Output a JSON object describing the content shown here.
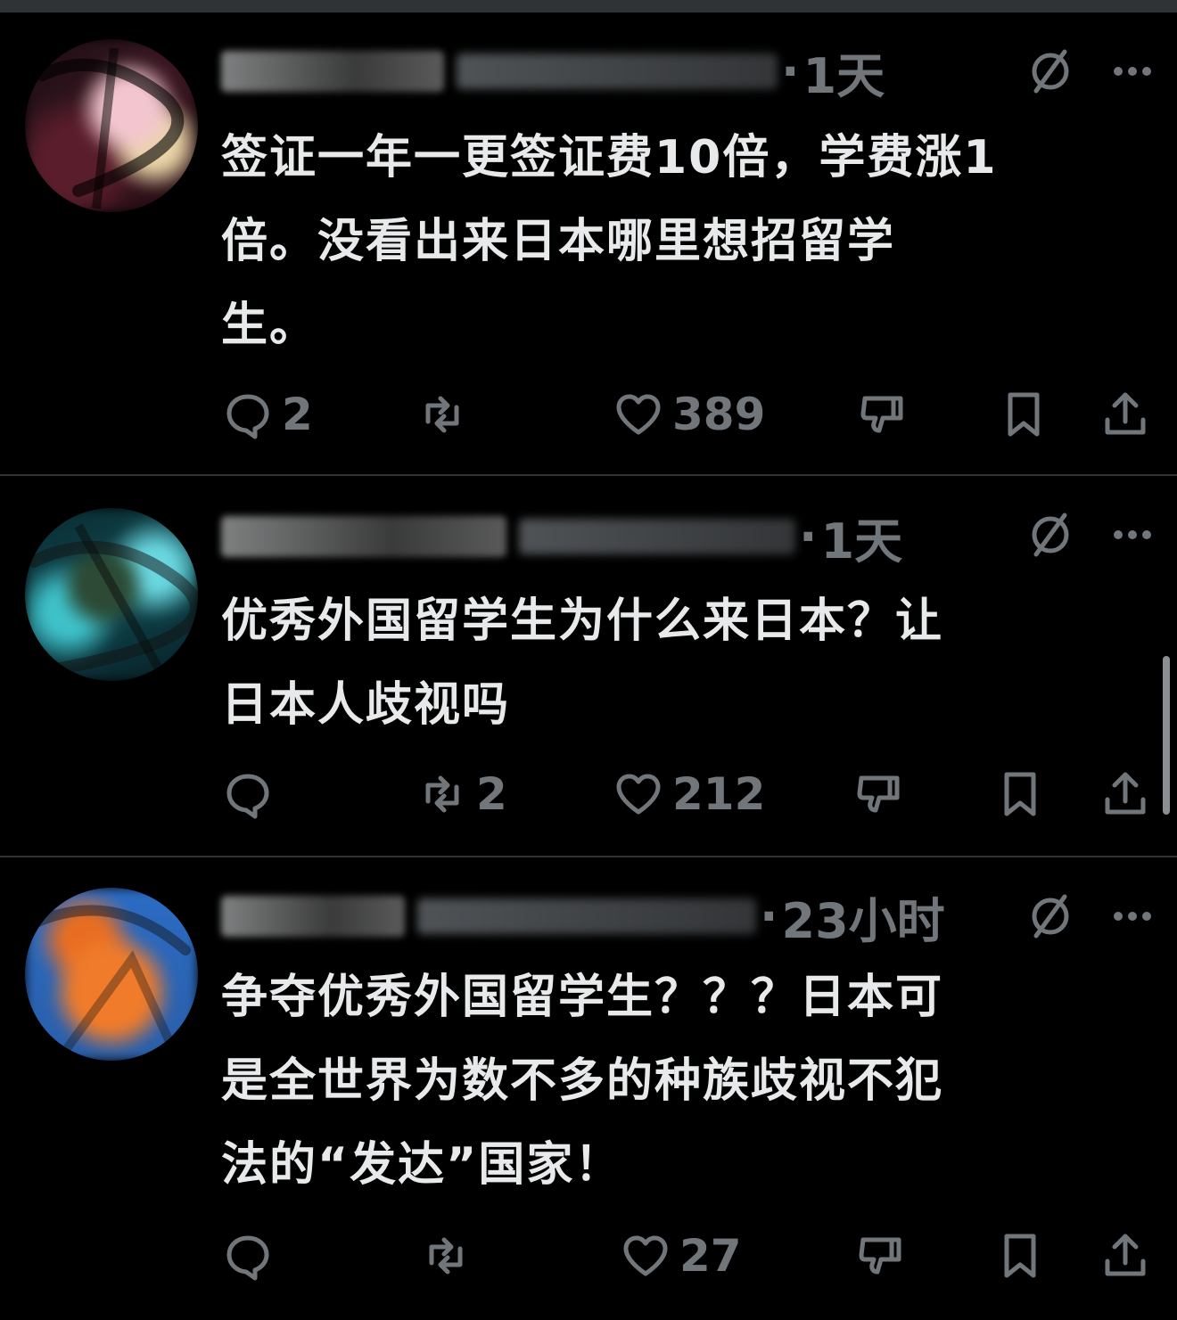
{
  "tweets": [
    {
      "name": "肥宅之蛙",
      "handle": "@humoregift",
      "time": "1天",
      "text": "签证一年一更签证费10倍，学费涨1倍。没看出来日本哪里想招留学生。",
      "lines": [
        "签证一年一更签证费10倍，学费涨1",
        "倍。没看出来日本哪里想招留学",
        "生。"
      ],
      "replies": "2",
      "retweets": "",
      "likes": "389"
    },
    {
      "name": "自由小蜜红",
      "handle": "@stagehs...",
      "time": "1天",
      "text": "优秀外国留学生为什么来日本？让日本人歧视吗",
      "lines": [
        "优秀外国留学生为什么来日本？让",
        "日本人歧视吗"
      ],
      "replies": "",
      "retweets": "2",
      "likes": "212"
    },
    {
      "name": "阿蒙.AI",
      "handle": "@hello_boris",
      "time": "23小时",
      "text": "争夺优秀外国留学生？？？日本可是全世界为数不多的种族歧视不犯法的“发达”国家！",
      "lines": [
        "争夺优秀外国留学生？？？日本可",
        "是全世界为数不多的种族歧视不犯",
        "法的“发达”国家！"
      ],
      "replies": "",
      "retweets": "",
      "likes": "27"
    }
  ],
  "icons": {
    "reply": "speech-bubble-icon",
    "retweet": "retweet-arrows-icon",
    "like": "heart-icon",
    "dislike": "thumbs-down-icon",
    "bookmark": "bookmark-icon",
    "share": "share-upload-icon",
    "grok": "grok-slash-icon",
    "more": "more-dots-icon"
  },
  "colors": {
    "background": "#000000",
    "text": "#e7e9ea",
    "muted": "#71767b",
    "divider": "#2f3336"
  }
}
